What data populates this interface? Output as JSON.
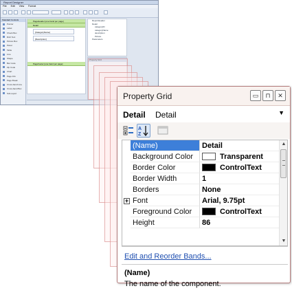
{
  "designer": {
    "title": "Report Designer",
    "menu": [
      "File",
      "Edit",
      "View",
      "Format"
    ],
    "toolbox_header": "Standard Controls",
    "toolbox_items": [
      "Pointer",
      "Label",
      "Check Box",
      "Rich Text",
      "Picture Box",
      "Panel",
      "Table",
      "Line",
      "Shape",
      "Bar Code",
      "Zip Code",
      "Chart",
      "Page Info",
      "Page Break",
      "Cross-band Line",
      "Cross-band Box",
      "Sub-report"
    ],
    "bands": [
      "PageHeader [one band per page]",
      "Detail",
      "PageFooter [one band per page]"
    ],
    "fields": [
      "[CategoryName]",
      "[Description]"
    ],
    "explorer_items": [
      "ReportHeader",
      "Detail",
      "categoryID",
      "categoryName",
      "description",
      "Picture",
      "Parameters"
    ],
    "miniprop_header": "Property Grid"
  },
  "property_grid": {
    "title": "Property Grid",
    "window_buttons": {
      "restore": "▭",
      "pin": "⊓",
      "close": "✕"
    },
    "object": {
      "type": "Detail",
      "name": "Detail"
    },
    "toolbar": [
      "categorized-icon",
      "alphabetical-icon",
      "property-pages-icon"
    ],
    "rows": [
      {
        "name": "(Name)",
        "value": "Detail",
        "swatch": null,
        "expandable": false,
        "selected": true
      },
      {
        "name": "Background Color",
        "value": "Transparent",
        "swatch": "#ffffff",
        "expandable": false,
        "selected": false
      },
      {
        "name": "Border Color",
        "value": "ControlText",
        "swatch": "#000000",
        "expandable": false,
        "selected": false
      },
      {
        "name": "Border Width",
        "value": "1",
        "swatch": null,
        "expandable": false,
        "selected": false
      },
      {
        "name": "Borders",
        "value": "None",
        "swatch": null,
        "expandable": false,
        "selected": false
      },
      {
        "name": "Font",
        "value": "Arial, 9.75pt",
        "swatch": null,
        "expandable": true,
        "selected": false
      },
      {
        "name": "Foreground Color",
        "value": "ControlText",
        "swatch": "#000000",
        "expandable": false,
        "selected": false
      },
      {
        "name": "Height",
        "value": "86",
        "swatch": null,
        "expandable": false,
        "selected": false
      }
    ],
    "command_link": "Edit and Reorder Bands...",
    "description": {
      "title": "(Name)",
      "text": "The name of the component."
    },
    "colors": {
      "selection": "#3d7fd9",
      "link": "#1f4fb0",
      "border": "#b27a7a"
    }
  }
}
